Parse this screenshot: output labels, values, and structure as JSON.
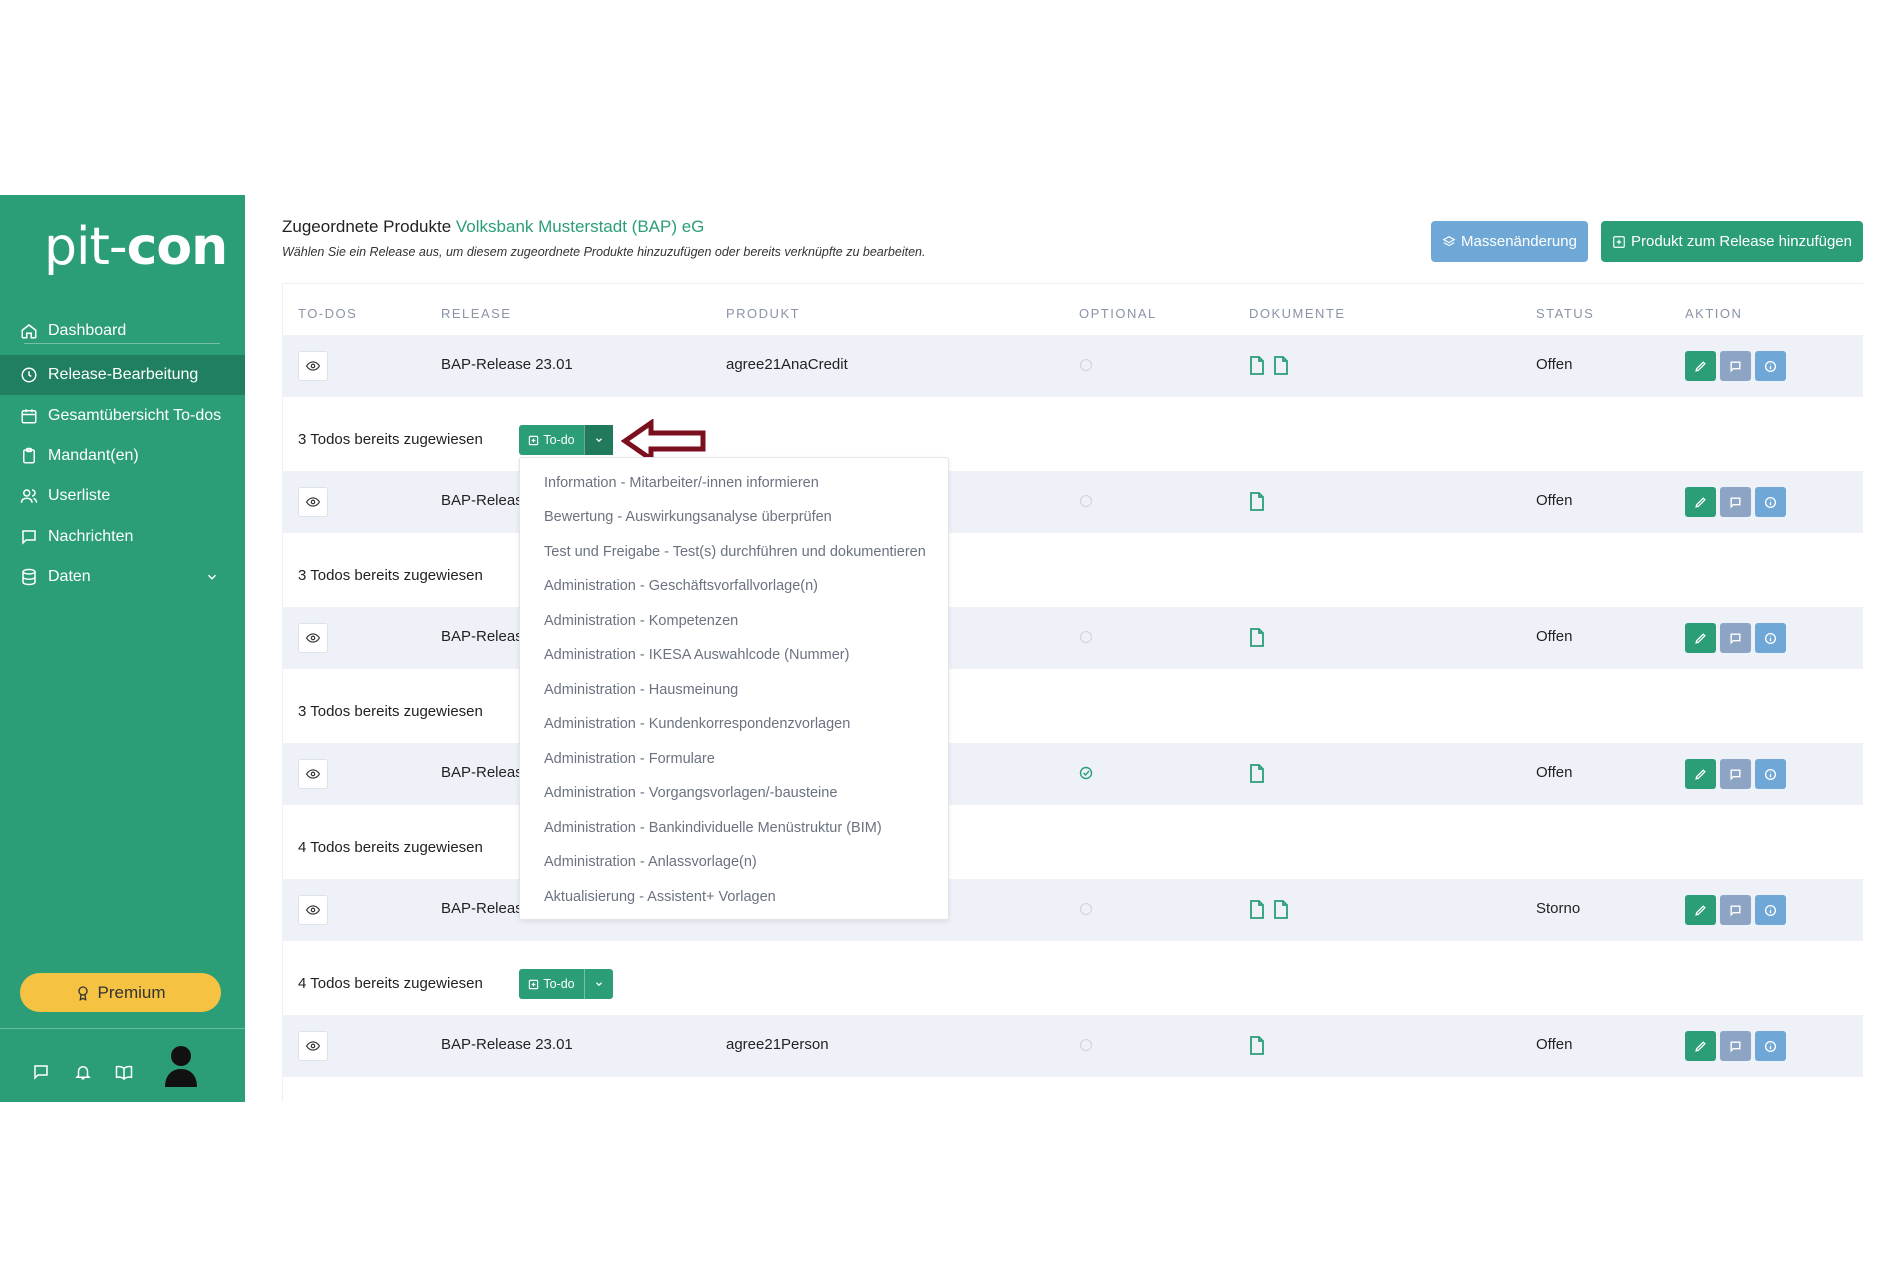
{
  "sidebar": {
    "logo_thin": "pit-",
    "logo_bold": "con",
    "items": [
      {
        "label": "Dashboard",
        "icon": "home-icon"
      },
      {
        "label": "Release-Bearbeitung",
        "icon": "clock-icon",
        "active": true
      },
      {
        "label": "Gesamtübersicht To-dos",
        "icon": "calendar-icon"
      },
      {
        "label": "Mandant(en)",
        "icon": "clipboard-icon"
      },
      {
        "label": "Userliste",
        "icon": "users-icon"
      },
      {
        "label": "Nachrichten",
        "icon": "message-icon"
      },
      {
        "label": "Daten",
        "icon": "database-icon"
      }
    ],
    "premium_label": "Premium"
  },
  "header": {
    "title_prefix": "Zugeordnete Produkte",
    "bank_name": "Volksbank Musterstadt (BAP) eG",
    "subtitle": "Wählen Sie ein Release aus, um diesem zugeordnete Produkte hinzuzufügen oder bereits verknüpfte zu bearbeiten.",
    "mass_button": "Massenänderung",
    "add_button": "Produkt zum Release hinzufügen"
  },
  "table": {
    "columns": [
      "TO-DOS",
      "RELEASE",
      "PRODUKT",
      "OPTIONAL",
      "DOKUMENTE",
      "STATUS",
      "AKTION"
    ],
    "rows": [
      {
        "release": "BAP-Release 23.01",
        "product": "agree21AnaCredit",
        "optional": false,
        "docs": 2,
        "status": "Offen",
        "todos": "3 Todos bereits zugewiesen"
      },
      {
        "release": "BAP-Releas",
        "product": "",
        "optional": false,
        "docs": 1,
        "status": "Offen",
        "todos": "3 Todos bereits zugewiesen"
      },
      {
        "release": "BAP-Releas",
        "product": "",
        "optional": false,
        "docs": 1,
        "status": "Offen",
        "todos": "3 Todos bereits zugewiesen"
      },
      {
        "release": "BAP-Releas",
        "product": "",
        "optional": true,
        "docs": 1,
        "status": "Offen",
        "todos": "4 Todos bereits zugewiesen"
      },
      {
        "release": "BAP-Releas",
        "product": "",
        "optional": false,
        "docs": 2,
        "status": "Storno",
        "todos": "4 Todos bereits zugewiesen"
      },
      {
        "release": "BAP-Release 23.01",
        "product": "agree21Person",
        "optional": false,
        "docs": 1,
        "status": "Offen",
        "todos": ""
      }
    ],
    "todo_button_label": "To-do"
  },
  "dropdown": {
    "items": [
      "Information - Mitarbeiter/-innen informieren",
      "Bewertung - Auswirkungsanalyse überprüfen",
      "Test und Freigabe - Test(s) durchführen und dokumentieren",
      "Administration - Geschäftsvorfallvorlage(n)",
      "Administration - Kompetenzen",
      "Administration - IKESA Auswahlcode (Nummer)",
      "Administration - Hausmeinung",
      "Administration - Kundenkorrespondenzvorlagen",
      "Administration - Formulare",
      "Administration - Vorgangsvorlagen/-bausteine",
      "Administration - Bankindividuelle Menüstruktur (BIM)",
      "Administration - Anlassvorlage(n)",
      "Aktualisierung - Assistent+ Vorlagen"
    ]
  },
  "colors": {
    "brand_green": "#2b9e78",
    "active_nav": "#1f7f60",
    "premium": "#f5c242",
    "info_blue": "#6fa8d6",
    "arrow_red": "#7a0f1e"
  }
}
